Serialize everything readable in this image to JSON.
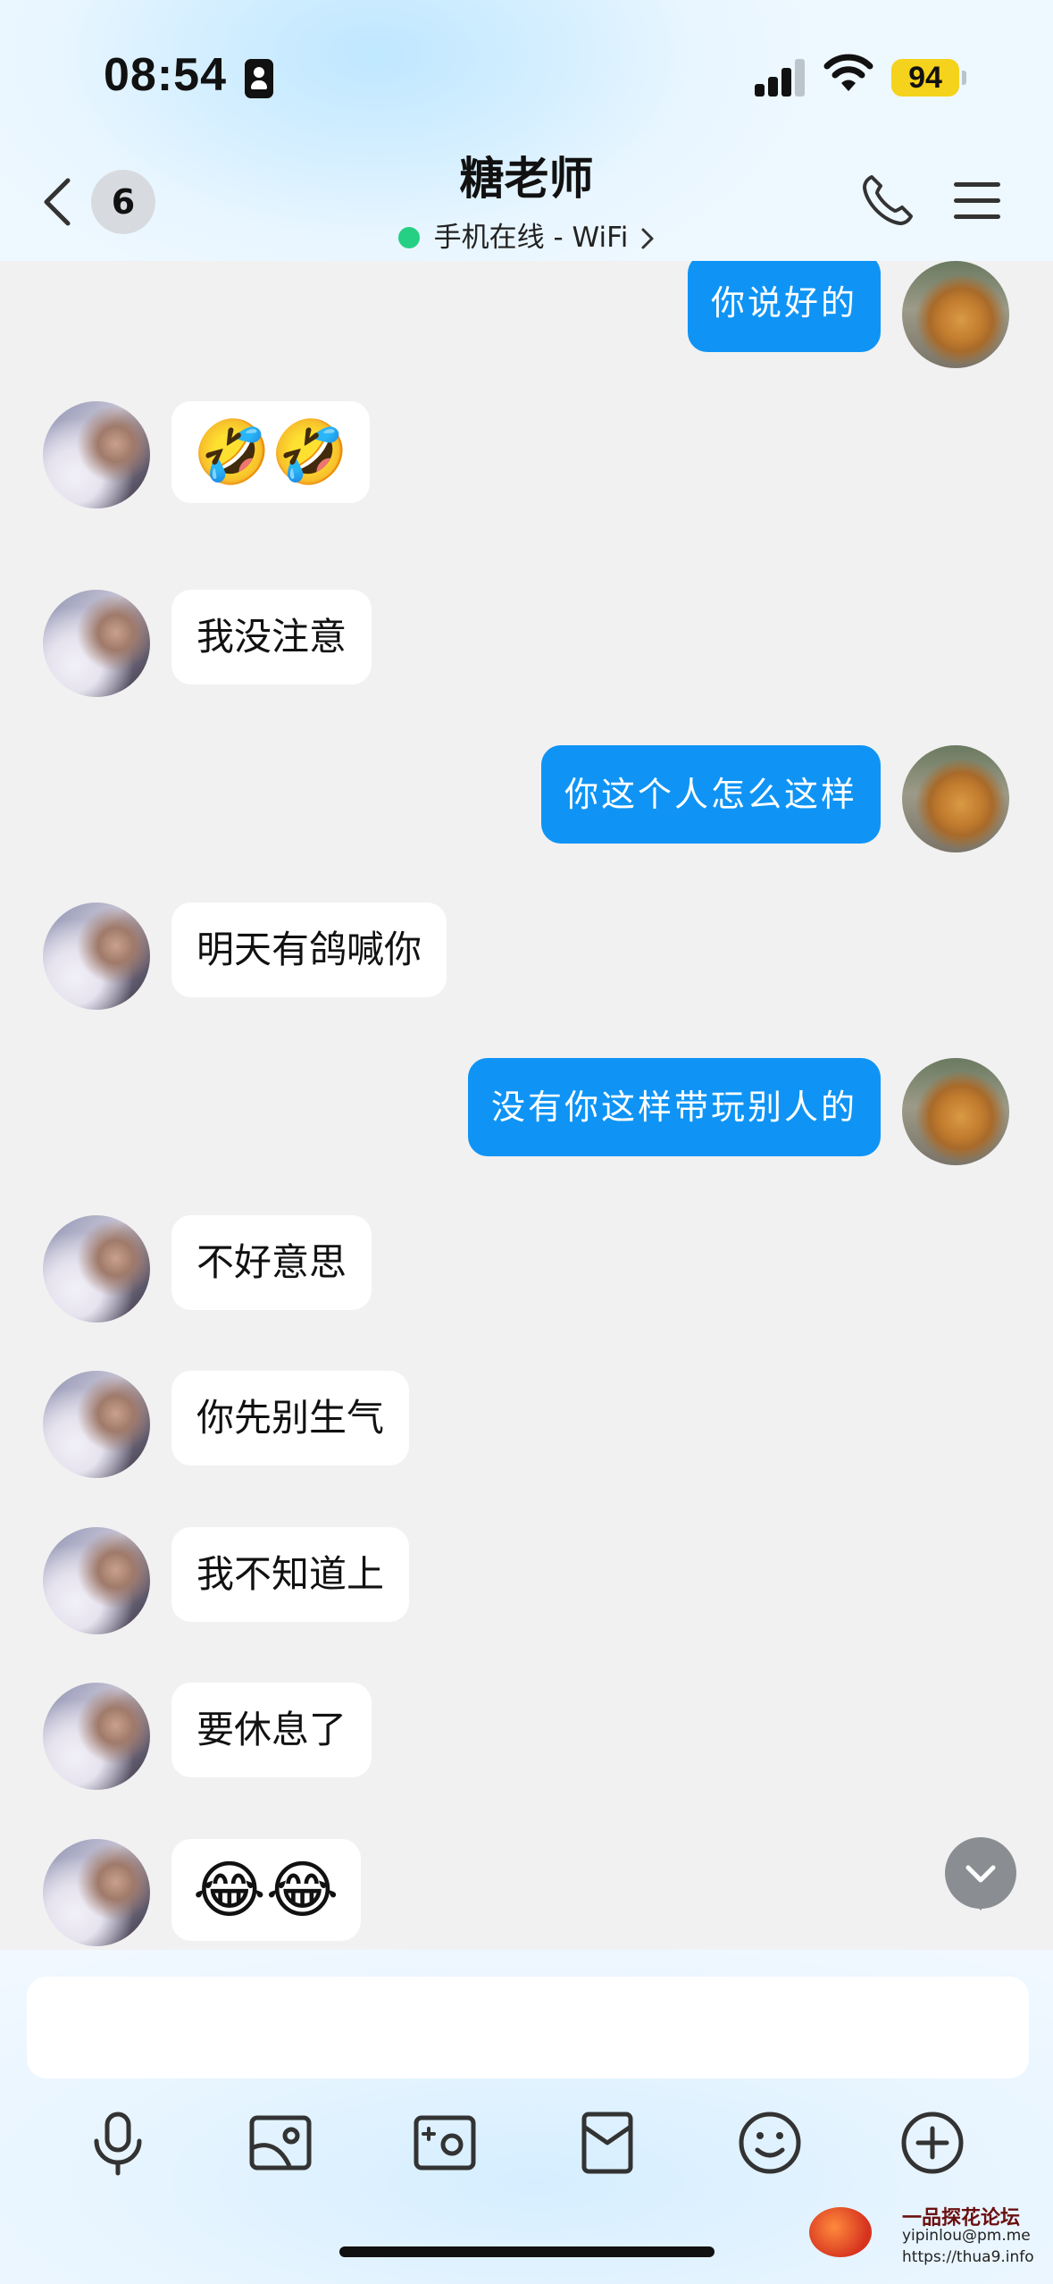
{
  "status_bar": {
    "time": "08:54",
    "battery": "94",
    "battery_color": "#f5d21b"
  },
  "header": {
    "unread_count": "6",
    "title": "糖老师",
    "presence": "手机在线 - WiFi",
    "presence_color": "#25d084"
  },
  "messages": [
    {
      "side": "out",
      "text": "你说好的"
    },
    {
      "side": "in",
      "text": "🤣🤣"
    },
    {
      "side": "in",
      "text": "我没注意"
    },
    {
      "side": "out",
      "text": "你这个人怎么这样"
    },
    {
      "side": "in",
      "text": "明天有鸽喊你"
    },
    {
      "side": "out",
      "text": "没有你这样带玩别人的"
    },
    {
      "side": "in",
      "text": "不好意思"
    },
    {
      "side": "in",
      "text": "你先别生气"
    },
    {
      "side": "in",
      "text": "我不知道上"
    },
    {
      "side": "in",
      "text": "要休息了"
    },
    {
      "side": "in",
      "text": "😂😂"
    }
  ],
  "composer": {
    "input_value": "",
    "tools": [
      "microphone-icon",
      "image-icon",
      "camera-icon",
      "red-packet-icon",
      "emoji-icon",
      "plus-icon"
    ]
  },
  "watermark": {
    "title": "一品探花论坛",
    "email": "yipinlou@pm.me",
    "url": "https://thua9.info"
  },
  "colors": {
    "outgoing_bubble": "#0f94f5",
    "incoming_bubble": "#ffffff",
    "background": "#f1f1f1"
  }
}
